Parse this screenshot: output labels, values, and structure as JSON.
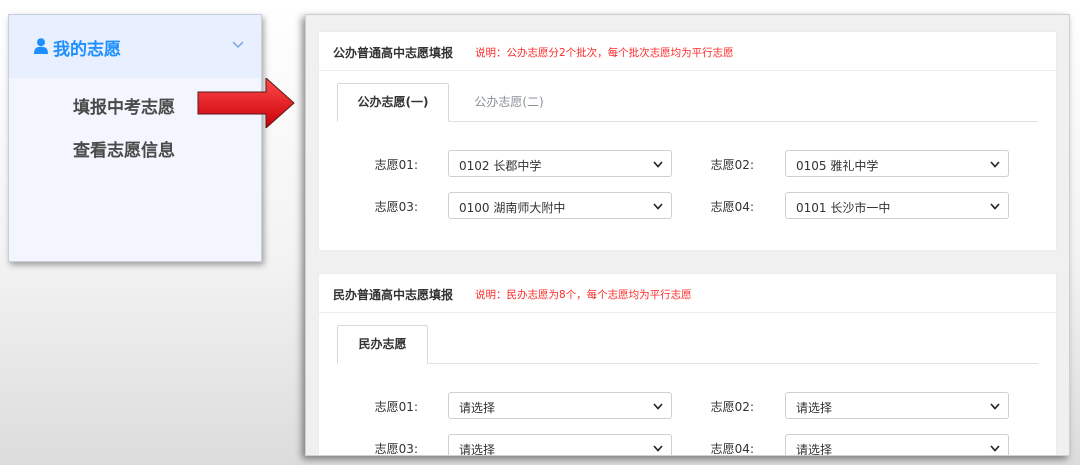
{
  "sidebar": {
    "title": "我的志愿",
    "items": [
      {
        "label": "填报中考志愿"
      },
      {
        "label": "查看志愿信息"
      }
    ]
  },
  "public": {
    "title": "公办普通高中志愿填报",
    "note": "说明：公办志愿分2个批次，每个批次志愿均为平行志愿",
    "tabs": [
      {
        "label": "公办志愿(一)",
        "active": true
      },
      {
        "label": "公办志愿(二)",
        "active": false
      }
    ],
    "fields": [
      {
        "label": "志愿01:",
        "value": "0102 长郡中学"
      },
      {
        "label": "志愿02:",
        "value": "0105 雅礼中学"
      },
      {
        "label": "志愿03:",
        "value": "0100 湖南师大附中"
      },
      {
        "label": "志愿04:",
        "value": "0101 长沙市一中"
      }
    ]
  },
  "private": {
    "title": "民办普通高中志愿填报",
    "note": "说明：民办志愿为8个，每个志愿均为平行志愿",
    "tabs": [
      {
        "label": "民办志愿",
        "active": true
      }
    ],
    "fields": [
      {
        "label": "志愿01:",
        "value": "请选择"
      },
      {
        "label": "志愿02:",
        "value": "请选择"
      },
      {
        "label": "志愿03:",
        "value": "请选择"
      },
      {
        "label": "志愿04:",
        "value": "请选择"
      }
    ]
  },
  "colors": {
    "accent": "#1f8fff",
    "note": "#ff2a2a",
    "arrow": "#e8000b"
  },
  "icons": [
    "user-icon",
    "chevron-down-icon",
    "red-arrow-icon",
    "select-caret-icon"
  ]
}
